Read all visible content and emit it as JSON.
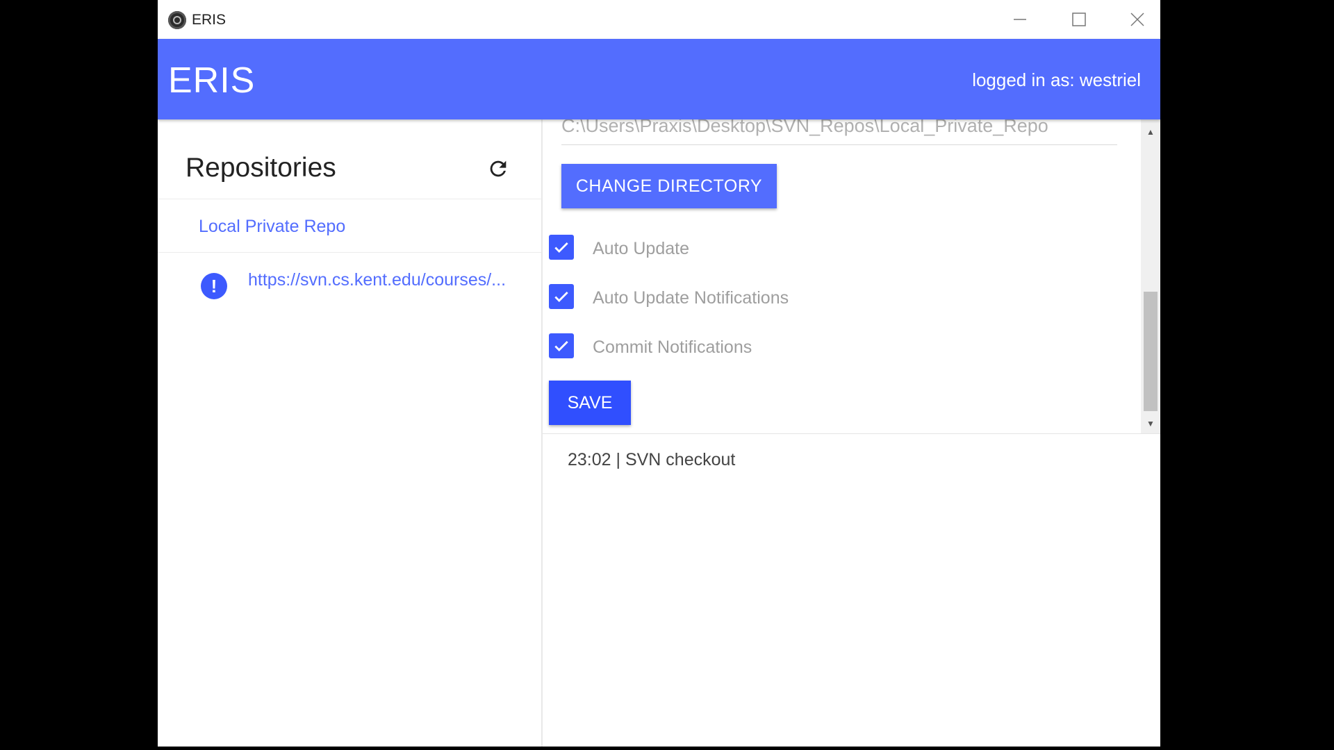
{
  "window": {
    "title": "ERIS",
    "controls": [
      "minimize-icon",
      "maximize-icon",
      "close-icon"
    ]
  },
  "header": {
    "title": "ERIS",
    "user_status": "logged in as: westriel",
    "color": "#536dfe"
  },
  "sidebar": {
    "title": "Repositories",
    "refresh_icon": "refresh-icon",
    "items": [
      {
        "label": "Local Private Repo",
        "icon": null
      },
      {
        "label": "https://svn.cs.kent.edu/courses/...",
        "icon": "alert-icon"
      }
    ]
  },
  "settings": {
    "directory_path": "C:\\Users\\Praxis\\Desktop\\SVN_Repos\\Local_Private_Repo",
    "change_directory_label": "CHANGE DIRECTORY",
    "options": [
      {
        "label": "Auto Update",
        "checked": true
      },
      {
        "label": "Auto Update Notifications",
        "checked": true
      },
      {
        "label": "Commit Notifications",
        "checked": true
      }
    ],
    "save_label": "SAVE"
  },
  "log": {
    "entries": [
      "23:02 | SVN checkout"
    ]
  }
}
